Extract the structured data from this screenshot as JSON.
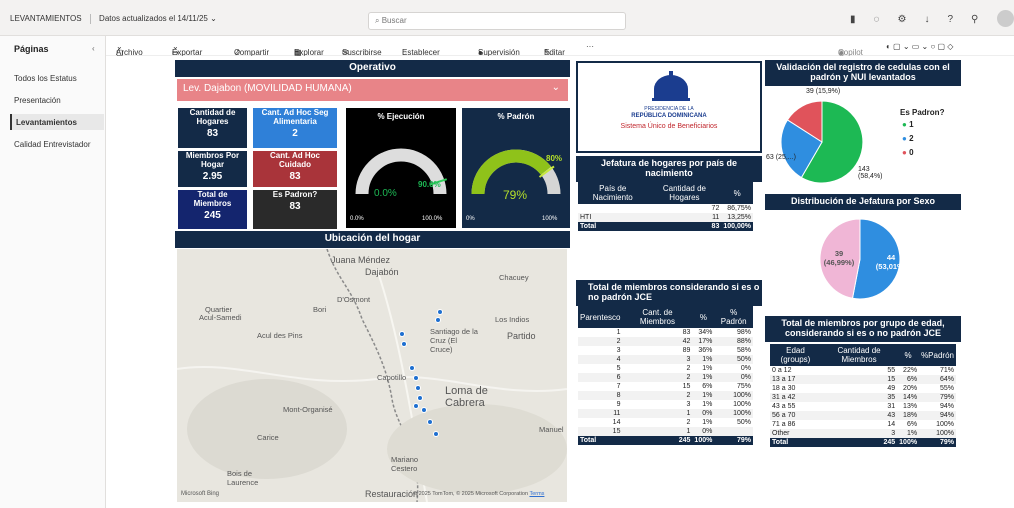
{
  "topbar": {
    "report_name": "LEVANTAMIENTOS",
    "updated": "Datos actualizados el 14/11/25",
    "search_placeholder": "Buscar"
  },
  "pages": {
    "title": "Páginas",
    "items": [
      "Todos los Estatus",
      "Presentación",
      "Levantamientos",
      "Calidad Entrevistador"
    ],
    "active": "Levantamientos"
  },
  "toolbar": {
    "archivo": "Archivo",
    "exportar": "Exportar",
    "compartir": "Compartir",
    "explorar": "Explorar",
    "suscribirse": "Suscribirse",
    "alerta": "Establecer alerta",
    "supervision": "Supervisión",
    "editar": "Editar",
    "more": "···",
    "copilot": "Copilot"
  },
  "operativo": {
    "title": "Operativo",
    "selected": "Lev. Dajabon (MOVILIDAD HUMANA)"
  },
  "cards": {
    "cantidad_hogares": {
      "label": "Cantidad de Hogares",
      "value": "83"
    },
    "cant_seg_alim": {
      "label": "Cant. Ad Hoc Seg Alimentaria",
      "value": "2"
    },
    "miembros_por_hogar": {
      "label": "Miembros Por Hogar",
      "value": "2.95"
    },
    "cant_cuidado": {
      "label": "Cant. Ad Hoc Cuidado",
      "value": "83"
    },
    "total_miembros": {
      "label": "Total de Miembros",
      "value": "245"
    },
    "es_padron": {
      "label": "Es Padron?",
      "value": "83"
    }
  },
  "gauge_ejecucion": {
    "title": "% Ejecución",
    "value_label": "0.0%",
    "target_label": "90.0%",
    "min_label": "0.0%",
    "max_label": "100.0%",
    "fraction": 0.0,
    "target_fraction": 0.9
  },
  "gauge_padron": {
    "title": "% Padrón",
    "value_label": "79%",
    "target_label": "80%",
    "min_label": "0%",
    "max_label": "100%",
    "fraction": 0.79,
    "target_fraction": 0.8
  },
  "map": {
    "title": "Ubicación del hogar",
    "labels": [
      "Juana Méndez",
      "Dajabón",
      "Chacuey",
      "D'Osmont",
      "Quartier",
      "Acul-Samedi",
      "Bori",
      "Acul des Pins",
      "Santiago de la Cruz (El Cruce)",
      "Los Indios",
      "Partido",
      "Capotillo",
      "Loma de Cabrera",
      "Mont-Organisé",
      "Carice",
      "Manuel",
      "Mariano Cestero",
      "Bois de Laurence",
      "Restauración"
    ],
    "attribution": "© 2025 TomTom, © 2025 Microsoft Corporation",
    "terms": "Terms",
    "brand": "Microsoft Bing"
  },
  "logo": {
    "line1": "PRESIDENCIA DE LA",
    "line2": "REPÚBLICA DOMINICANA",
    "line3": "Sistema Único de Beneficiarios"
  },
  "jefatura_pais": {
    "title": "Jefatura de hogares por país de nacimiento",
    "headers": [
      "País de Nacimiento",
      "Cantidad de Hogares",
      "%"
    ],
    "rows": [
      [
        "",
        "72",
        "86,75%"
      ],
      [
        "HTI",
        "11",
        "13,25%"
      ]
    ],
    "total": [
      "Total",
      "83",
      "100,00%"
    ]
  },
  "miembros_parentesco": {
    "title": "Total de miembros considerando si es o no padrón JCE",
    "headers": [
      "Parentesco",
      "Cant. de Miembros",
      "%",
      "% Padrón"
    ],
    "rows": [
      [
        "1",
        "83",
        "34%",
        "98%"
      ],
      [
        "2",
        "42",
        "17%",
        "88%"
      ],
      [
        "3",
        "89",
        "36%",
        "58%"
      ],
      [
        "4",
        "3",
        "1%",
        "50%"
      ],
      [
        "5",
        "2",
        "1%",
        "0%"
      ],
      [
        "6",
        "2",
        "1%",
        "0%"
      ],
      [
        "7",
        "15",
        "6%",
        "75%"
      ],
      [
        "8",
        "2",
        "1%",
        "100%"
      ],
      [
        "9",
        "3",
        "1%",
        "100%"
      ],
      [
        "11",
        "1",
        "0%",
        "100%"
      ],
      [
        "14",
        "2",
        "1%",
        "50%"
      ],
      [
        "15",
        "1",
        "0%",
        ""
      ]
    ],
    "total": [
      "Total",
      "245",
      "100%",
      "79%"
    ]
  },
  "validacion": {
    "title": "Validación del registro de cedulas con el padrón y NUI levantados",
    "legend_title": "Es Padron?",
    "legend": [
      {
        "label": "1",
        "color": "#1db954"
      },
      {
        "label": "2",
        "color": "#2f8ee0"
      },
      {
        "label": "0",
        "color": "#e0535b"
      }
    ],
    "labels": [
      "39 (15,9%)",
      "63 (25,...)",
      "143 (58,4%)"
    ]
  },
  "sexo": {
    "title": "Distribución de Jefatura por Sexo",
    "labels": [
      "39 (46,99%)",
      "44 (53,01%)"
    ]
  },
  "edad": {
    "title": "Total de miembros por grupo de edad, considerando si es o no padrón JCE",
    "headers": [
      "Edad (groups)",
      "Cantidad de Miembros",
      "%",
      "%Padrón"
    ],
    "rows": [
      [
        "0 a 12",
        "55",
        "22%",
        "71%"
      ],
      [
        "13 a 17",
        "15",
        "6%",
        "64%"
      ],
      [
        "18 a 30",
        "49",
        "20%",
        "55%"
      ],
      [
        "31 a 42",
        "35",
        "14%",
        "79%"
      ],
      [
        "43 a 55",
        "31",
        "13%",
        "94%"
      ],
      [
        "56 a 70",
        "43",
        "18%",
        "94%"
      ],
      [
        "71 a 86",
        "14",
        "6%",
        "100%"
      ],
      [
        "Other",
        "3",
        "1%",
        "100%"
      ]
    ],
    "total": [
      "Total",
      "245",
      "100%",
      "79%"
    ]
  },
  "chart_data": [
    {
      "type": "pie",
      "title": "Validación del registro de cedulas con el padrón y NUI levantados",
      "categories": [
        "1",
        "2",
        "0"
      ],
      "values": [
        143,
        63,
        39
      ],
      "colors": [
        "#1db954",
        "#2f8ee0",
        "#e0535b"
      ]
    },
    {
      "type": "pie",
      "title": "Distribución de Jefatura por Sexo",
      "values": [
        44,
        39
      ],
      "colors": [
        "#2f8ee0",
        "#f0b6d6"
      ]
    }
  ]
}
